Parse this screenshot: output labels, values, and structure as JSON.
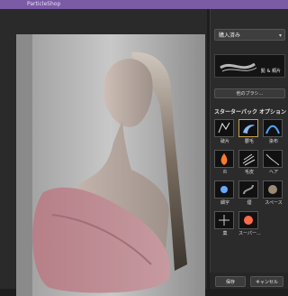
{
  "window": {
    "title": "ParticleShop"
  },
  "panel": {
    "preset_select": "購入済み",
    "brush_preview_label": "髭 & 頬片",
    "other_brushes_button": "他のブラシ...",
    "starter_pack_label": "スターターパック オプション",
    "brushes": [
      {
        "label": "破片",
        "icon": "shards-icon"
      },
      {
        "label": "鬱毛",
        "icon": "crescent-icon"
      },
      {
        "label": "染布",
        "icon": "fabric-icon"
      },
      {
        "label": "炎",
        "icon": "fire-icon"
      },
      {
        "label": "毛皮",
        "icon": "fur-icon"
      },
      {
        "label": "ヘア",
        "icon": "hair-icon"
      },
      {
        "label": "細字",
        "icon": "light-icon"
      },
      {
        "label": "煙",
        "icon": "smoke-icon"
      },
      {
        "label": "スペース",
        "icon": "space-icon"
      },
      {
        "label": "菓",
        "icon": "sparkle-icon"
      },
      {
        "label": "スーパー...",
        "icon": "burst-icon"
      }
    ]
  },
  "footer": {
    "save_label": "保存",
    "cancel_label": "キャンセル"
  },
  "colors": {
    "titlebar": "#7b5aa6",
    "accent": "#c9a34a"
  }
}
